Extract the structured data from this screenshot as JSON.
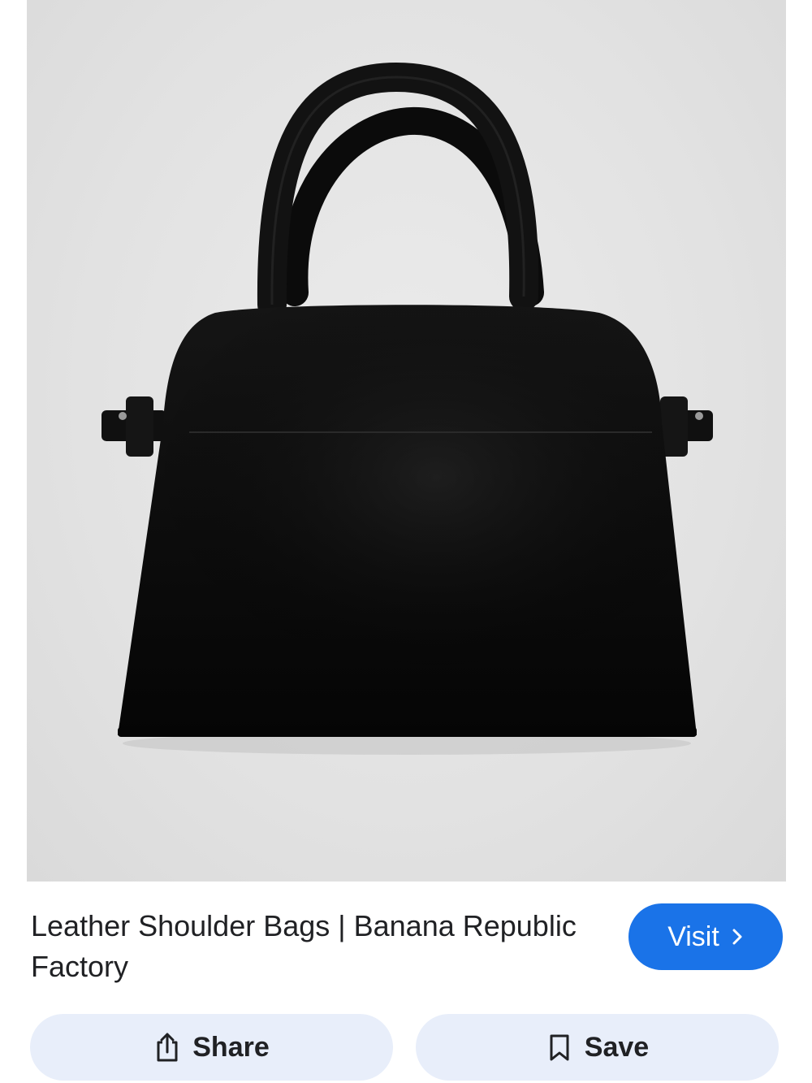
{
  "result": {
    "title": "Leather Shoulder Bags | Banana Republic Factory",
    "image_subject": "black leather top-handle shoulder bag"
  },
  "actions": {
    "visit_label": "Visit",
    "share_label": "Share",
    "save_label": "Save"
  },
  "colors": {
    "primary": "#1a73e8",
    "action_bg": "#e8eefa",
    "text": "#202124"
  },
  "icons": {
    "visit": "chevron-right-icon",
    "share": "share-icon",
    "save": "bookmark-icon"
  }
}
